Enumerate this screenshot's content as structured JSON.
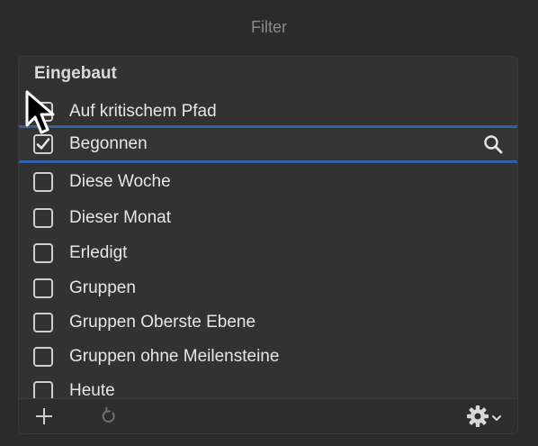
{
  "window": {
    "title": "Filter"
  },
  "section": {
    "header": "Eingebaut"
  },
  "items": [
    {
      "label": "Auf kritischem Pfad",
      "checked": false
    },
    {
      "label": "Begonnen",
      "checked": true,
      "selected": true
    },
    {
      "label": "Diese Woche",
      "checked": false
    },
    {
      "label": "Dieser Monat",
      "checked": false
    },
    {
      "label": "Erledigt",
      "checked": false
    },
    {
      "label": "Gruppen",
      "checked": false
    },
    {
      "label": "Gruppen Oberste Ebene",
      "checked": false
    },
    {
      "label": "Gruppen ohne Meilensteine",
      "checked": false
    },
    {
      "label": "Heute",
      "checked": false
    }
  ],
  "icons": {
    "add": "plus-icon",
    "refresh": "refresh-icon",
    "settings": "gear-icon",
    "search": "search-icon"
  },
  "colors": {
    "selection_line": "#2f5fa8",
    "text": "#e6e6e6"
  }
}
